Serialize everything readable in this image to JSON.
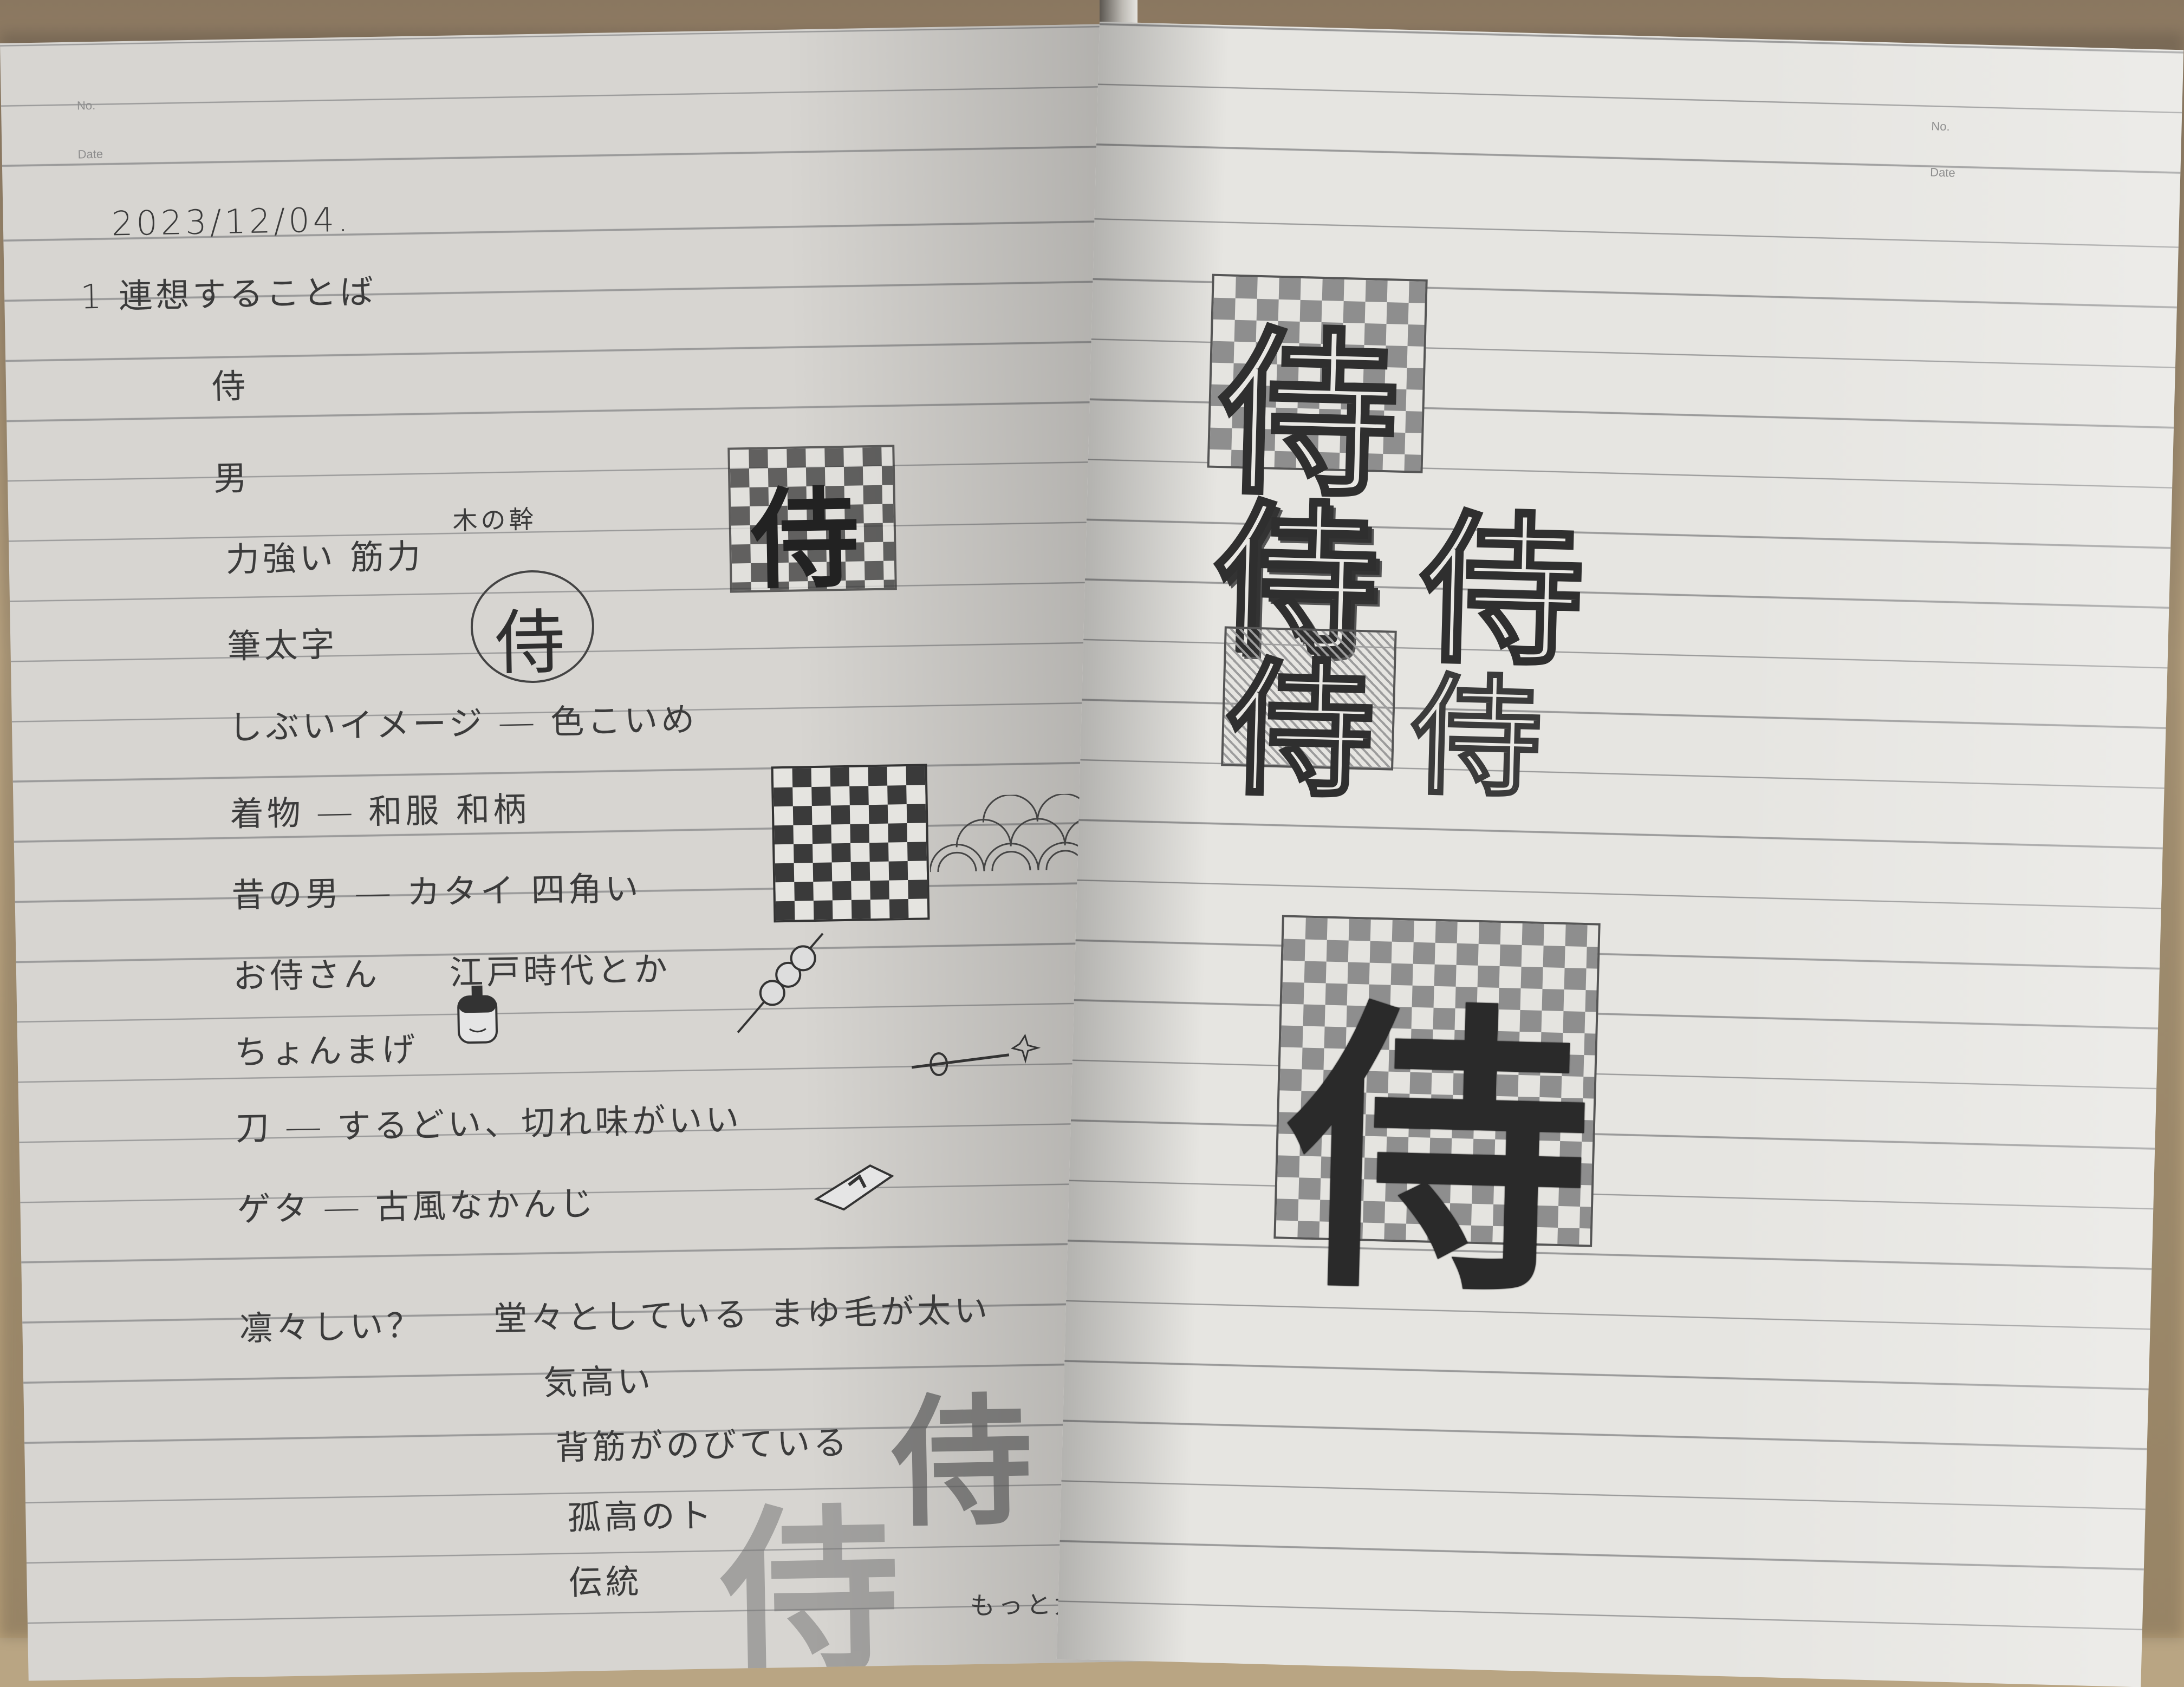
{
  "header": {
    "no_label_left": "No.",
    "date_label_left": "Date",
    "no_label_right": "No.",
    "date_label_right": "Date"
  },
  "left_page": {
    "date": "2023/12/04.",
    "heading": "1 連想することば",
    "lines": [
      "侍",
      "男",
      "力強い 筋力",
      "筆太字",
      "しぶいイメージ ― 色こいめ",
      "着物 ― 和服 和柄",
      "昔の男 ― カタイ 四角い",
      "お侍さん",
      "ちょんまげ",
      "刀 ― するどい、切れ味がいい",
      "ゲタ ― 古風なかんじ",
      "凛々しい？"
    ],
    "annotations": {
      "wood_trunk": "木の幹",
      "edo": "江戸時代とか",
      "circle_kanji": "侍",
      "checker_kanji": "侍"
    },
    "rin_notes": [
      "堂々としている",
      "まゆ毛が太い",
      "気高い",
      "背筋がのびている",
      "孤高のト",
      "伝統"
    ],
    "bottom_note": "もっと太く"
  },
  "right_page": {
    "sketch_kanji": [
      "侍",
      "侍",
      "侍",
      "侍",
      "侍",
      "侍"
    ]
  }
}
